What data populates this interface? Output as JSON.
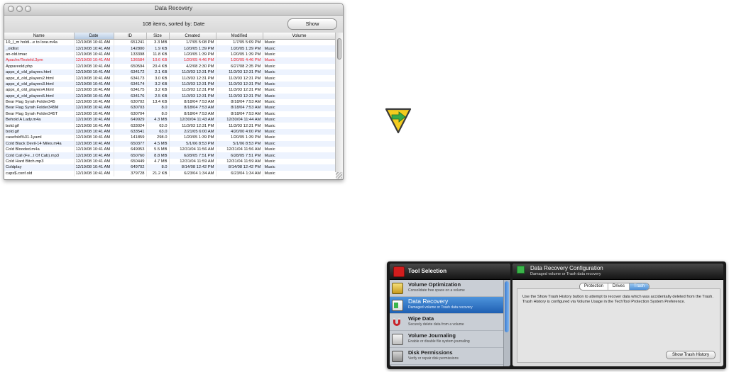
{
  "window": {
    "title": "Data Recovery",
    "info": "108 items, sorted by: Date",
    "show_button": "Show"
  },
  "table": {
    "columns": [
      "Name",
      "Date",
      "ID",
      "Size",
      "Created",
      "Modified",
      "Volume"
    ],
    "rows": [
      [
        "10_I_m holdi...e to love.m4a",
        "12/19/08 10:41 AM",
        "651241",
        "3.3 MB",
        "1/7/05 5:08 PM",
        "1/7/05 5:09 PM",
        "Music"
      ],
      [
        "_oldlist",
        "12/19/08 10:41 AM",
        "142800",
        "1.9 KB",
        "1/20/05 1:39 PM",
        "1/20/05 1:39 PM",
        "Music"
      ],
      [
        "an-old.tmac",
        "12/19/08 10:41 AM",
        "133398",
        "11.8 KB",
        "1/20/05 1:39 PM",
        "1/20/05 1:39 PM",
        "Music"
      ],
      [
        "Apache/Testeld.3pm",
        "12/19/08 10:41 AM",
        "136584",
        "10.6 KB",
        "1/20/05 4:46 PM",
        "1/20/05 4:46 PM",
        "Music"
      ],
      [
        "Appareold.php",
        "12/19/08 10:41 AM",
        "650594",
        "20.4 KB",
        "4/2/08 2:30 PM",
        "6/27/08 2:35 PM",
        "Music"
      ],
      [
        "appx_d_old_players.html",
        "12/19/08 10:41 AM",
        "634172",
        "2.1 KB",
        "11/3/03 12:31 PM",
        "11/3/03 12:31 PM",
        "Music"
      ],
      [
        "appx_d_old_players2.html",
        "12/19/08 10:41 AM",
        "634173",
        "3.0 KB",
        "11/3/03 12:31 PM",
        "11/3/03 12:31 PM",
        "Music"
      ],
      [
        "appx_d_old_players3.html",
        "12/19/08 10:41 AM",
        "634174",
        "3.2 KB",
        "11/3/03 12:31 PM",
        "11/3/03 12:31 PM",
        "Music"
      ],
      [
        "appx_d_old_players4.html",
        "12/19/08 10:41 AM",
        "634175",
        "3.2 KB",
        "11/3/03 12:31 PM",
        "11/3/03 12:31 PM",
        "Music"
      ],
      [
        "appx_d_old_players5.html",
        "12/19/08 10:41 AM",
        "634176",
        "2.5 KB",
        "11/3/03 12:31 PM",
        "11/3/03 12:31 PM",
        "Music"
      ],
      [
        "Bear Flag Syrah Folder345",
        "12/19/08 10:41 AM",
        "630702",
        "13.4 KB",
        "8/18/04 7:53 AM",
        "8/18/04 7:53 AM",
        "Music"
      ],
      [
        "Bear Flag Syrah Folder345M",
        "12/19/08 10:41 AM",
        "630703",
        "8.0",
        "8/18/04 7:53 AM",
        "8/18/04 7:53 AM",
        "Music"
      ],
      [
        "Bear Flag Syrah Folder345T",
        "12/19/08 10:41 AM",
        "630704",
        "8.0",
        "8/18/04 7:53 AM",
        "8/18/04 7:53 AM",
        "Music"
      ],
      [
        "Behold A Lady.m4a",
        "12/19/08 10:41 AM",
        "649929",
        "4.3 MB",
        "12/30/04 11:43 AM",
        "12/30/04 11:44 AM",
        "Music"
      ],
      [
        "bold.gif",
        "12/19/08 10:41 AM",
        "633024",
        "63.0",
        "11/3/03 12:31 PM",
        "11/3/03 12:31 PM",
        "Music"
      ],
      [
        "bold.gif",
        "12/19/08 10:41 AM",
        "633541",
        "63.0",
        "2/21/05 6:00 AM",
        "4/20/00 4:00 PM",
        "Music"
      ],
      [
        "casefold%31-1yaml",
        "12/19/08 10:41 AM",
        "141859",
        "298.0",
        "1/20/05 1:39 PM",
        "1/20/05 1:39 PM",
        "Music"
      ],
      [
        "Cold Black Devil-14 Miles.m4a",
        "12/19/08 10:41 AM",
        "650377",
        "4.5 MB",
        "5/1/06 8:53 PM",
        "5/1/06 8:53 PM",
        "Music"
      ],
      [
        "Cold Blooded.m4a",
        "12/19/08 10:41 AM",
        "649053",
        "5.5 MB",
        "12/31/04 11:56 AM",
        "12/31/04 11:56 AM",
        "Music"
      ],
      [
        "Cold Call (Fe...t Of Cab).mp3",
        "12/19/08 10:41 AM",
        "650760",
        "8.8 MB",
        "6/28/05 7:51 PM",
        "6/28/05 7:51 PM",
        "Music"
      ],
      [
        "Cold Hard Bitch.mp3",
        "12/19/08 10:41 AM",
        "650449",
        "4.7 MB",
        "12/31/04 11:59 AM",
        "12/31/04 11:59 AM",
        "Music"
      ],
      [
        "Coldplay",
        "12/19/08 10:41 AM",
        "649702",
        "8.0",
        "8/14/08 12:42 PM",
        "8/14/08 12:42 PM",
        "Music"
      ],
      [
        "cups$.conf.old",
        "12/19/08 10:41 AM",
        "379728",
        "21.2 KB",
        "6/23/04 1:34 AM",
        "6/23/04 1:34 AM",
        "Music"
      ]
    ]
  },
  "techtool": {
    "sidebar_title": "Tool Selection",
    "tools": [
      {
        "name": "Volume Optimization",
        "desc": "Consolidate free space on a volume"
      },
      {
        "name": "Data Recovery",
        "desc": "Damaged volume or Trash data recovery"
      },
      {
        "name": "Wipe Data",
        "desc": "Securely delete data from a volume"
      },
      {
        "name": "Volume Journaling",
        "desc": "Enable or disable file system journaling"
      },
      {
        "name": "Disk Permissions",
        "desc": "Verify or repair disk permissions"
      }
    ],
    "config_title": "Data Recovery Configuration",
    "config_subtitle": "Damaged volume or Trash data recovery",
    "segments": [
      "Protection",
      "Drives",
      "Trash"
    ],
    "description": "Use the Show Trash History button to attempt to recover data which was accidentally deleted from the Trash. Trash History is configured via Volume Usage in the TechTool Protection System Preference.",
    "show_history_button": "Show Trash History"
  },
  "colors": {
    "deleted_row": "#e8202a",
    "selection": "#1e5fb2",
    "arrow_badge": "#f4cc1e",
    "arrow": "#37a948"
  }
}
